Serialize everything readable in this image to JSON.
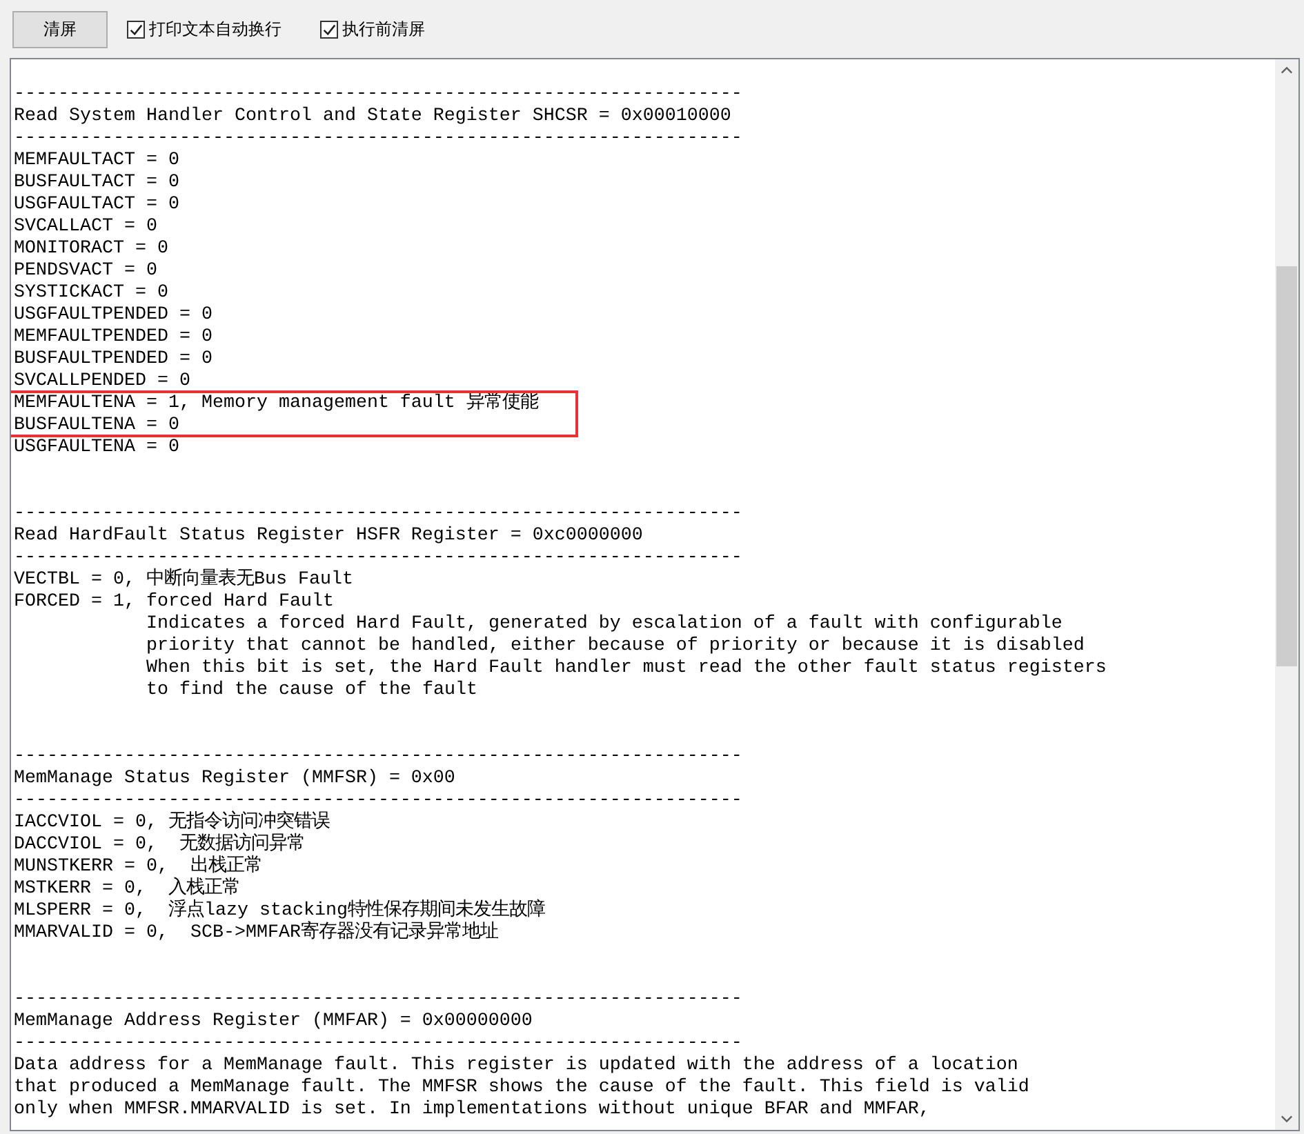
{
  "toolbar": {
    "clear_button": "清屏",
    "checkboxes": [
      {
        "label": "打印文本自动换行",
        "checked": true
      },
      {
        "label": "执行前清屏",
        "checked": true
      }
    ]
  },
  "output": {
    "lines": [
      {
        "kind": "blank"
      },
      {
        "kind": "text",
        "text": "------------------------------------------------------------------"
      },
      {
        "kind": "text",
        "text": "Read System Handler Control and State Register SHCSR = 0x00010000"
      },
      {
        "kind": "text",
        "text": "------------------------------------------------------------------"
      },
      {
        "kind": "text",
        "text": "MEMFAULTACT = 0"
      },
      {
        "kind": "text",
        "text": "BUSFAULTACT = 0"
      },
      {
        "kind": "text",
        "text": "USGFAULTACT = 0"
      },
      {
        "kind": "text",
        "text": "SVCALLACT = 0"
      },
      {
        "kind": "text",
        "text": "MONITORACT = 0"
      },
      {
        "kind": "text",
        "text": "PENDSVACT = 0"
      },
      {
        "kind": "text",
        "text": "SYSTICKACT = 0"
      },
      {
        "kind": "text",
        "text": "USGFAULTPENDED = 0"
      },
      {
        "kind": "text",
        "text": "MEMFAULTPENDED = 0"
      },
      {
        "kind": "text",
        "text": "BUSFAULTPENDED = 0"
      },
      {
        "kind": "text",
        "text": "SVCALLPENDED = 0"
      },
      {
        "kind": "text",
        "text": "MEMFAULTENA = 1, Memory management fault 异常使能",
        "highlighted": true
      },
      {
        "kind": "text",
        "text": "BUSFAULTENA = 0"
      },
      {
        "kind": "text",
        "text": "USGFAULTENA = 0"
      },
      {
        "kind": "blank"
      },
      {
        "kind": "blank"
      },
      {
        "kind": "text",
        "text": "------------------------------------------------------------------"
      },
      {
        "kind": "text",
        "text": "Read HardFault Status Register HSFR Register = 0xc0000000"
      },
      {
        "kind": "text",
        "text": "------------------------------------------------------------------"
      },
      {
        "kind": "text",
        "text": "VECTBL = 0, 中断向量表无Bus Fault"
      },
      {
        "kind": "text",
        "text": "FORCED = 1, forced Hard Fault"
      },
      {
        "kind": "continuation",
        "text": "Indicates a forced Hard Fault, generated by escalation of a fault with configurable"
      },
      {
        "kind": "continuation",
        "text": "priority that cannot be handled, either because of priority or because it is disabled"
      },
      {
        "kind": "continuation",
        "text": "When this bit is set, the Hard Fault handler must read the other fault status registers"
      },
      {
        "kind": "continuation",
        "text": "to find the cause of the fault"
      },
      {
        "kind": "blank"
      },
      {
        "kind": "blank"
      },
      {
        "kind": "text",
        "text": "------------------------------------------------------------------"
      },
      {
        "kind": "text",
        "text": "MemManage Status Register (MMFSR) = 0x00"
      },
      {
        "kind": "text",
        "text": "------------------------------------------------------------------"
      },
      {
        "kind": "text",
        "text": "IACCVIOL = 0, 无指令访问冲突错误"
      },
      {
        "kind": "text",
        "text": "DACCVIOL = 0,  无数据访问异常"
      },
      {
        "kind": "text",
        "text": "MUNSTKERR = 0,  出栈正常"
      },
      {
        "kind": "text",
        "text": "MSTKERR = 0,  入栈正常"
      },
      {
        "kind": "text",
        "text": "MLSPERR = 0,  浮点lazy stacking特性保存期间未发生故障"
      },
      {
        "kind": "text",
        "text": "MMARVALID = 0,  SCB->MMFAR寄存器没有记录异常地址"
      },
      {
        "kind": "blank"
      },
      {
        "kind": "blank"
      },
      {
        "kind": "text",
        "text": "------------------------------------------------------------------"
      },
      {
        "kind": "text",
        "text": "MemManage Address Register (MMFAR) = 0x00000000"
      },
      {
        "kind": "text",
        "text": "------------------------------------------------------------------"
      },
      {
        "kind": "text",
        "text": "Data address for a MemManage fault. This register is updated with the address of a location"
      },
      {
        "kind": "text",
        "text": "that produced a MemManage fault. The MMFSR shows the cause of the fault. This field is valid"
      },
      {
        "kind": "text",
        "text": "only when MMFSR.MMARVALID is set. In implementations without unique BFAR and MMFAR,"
      }
    ]
  }
}
